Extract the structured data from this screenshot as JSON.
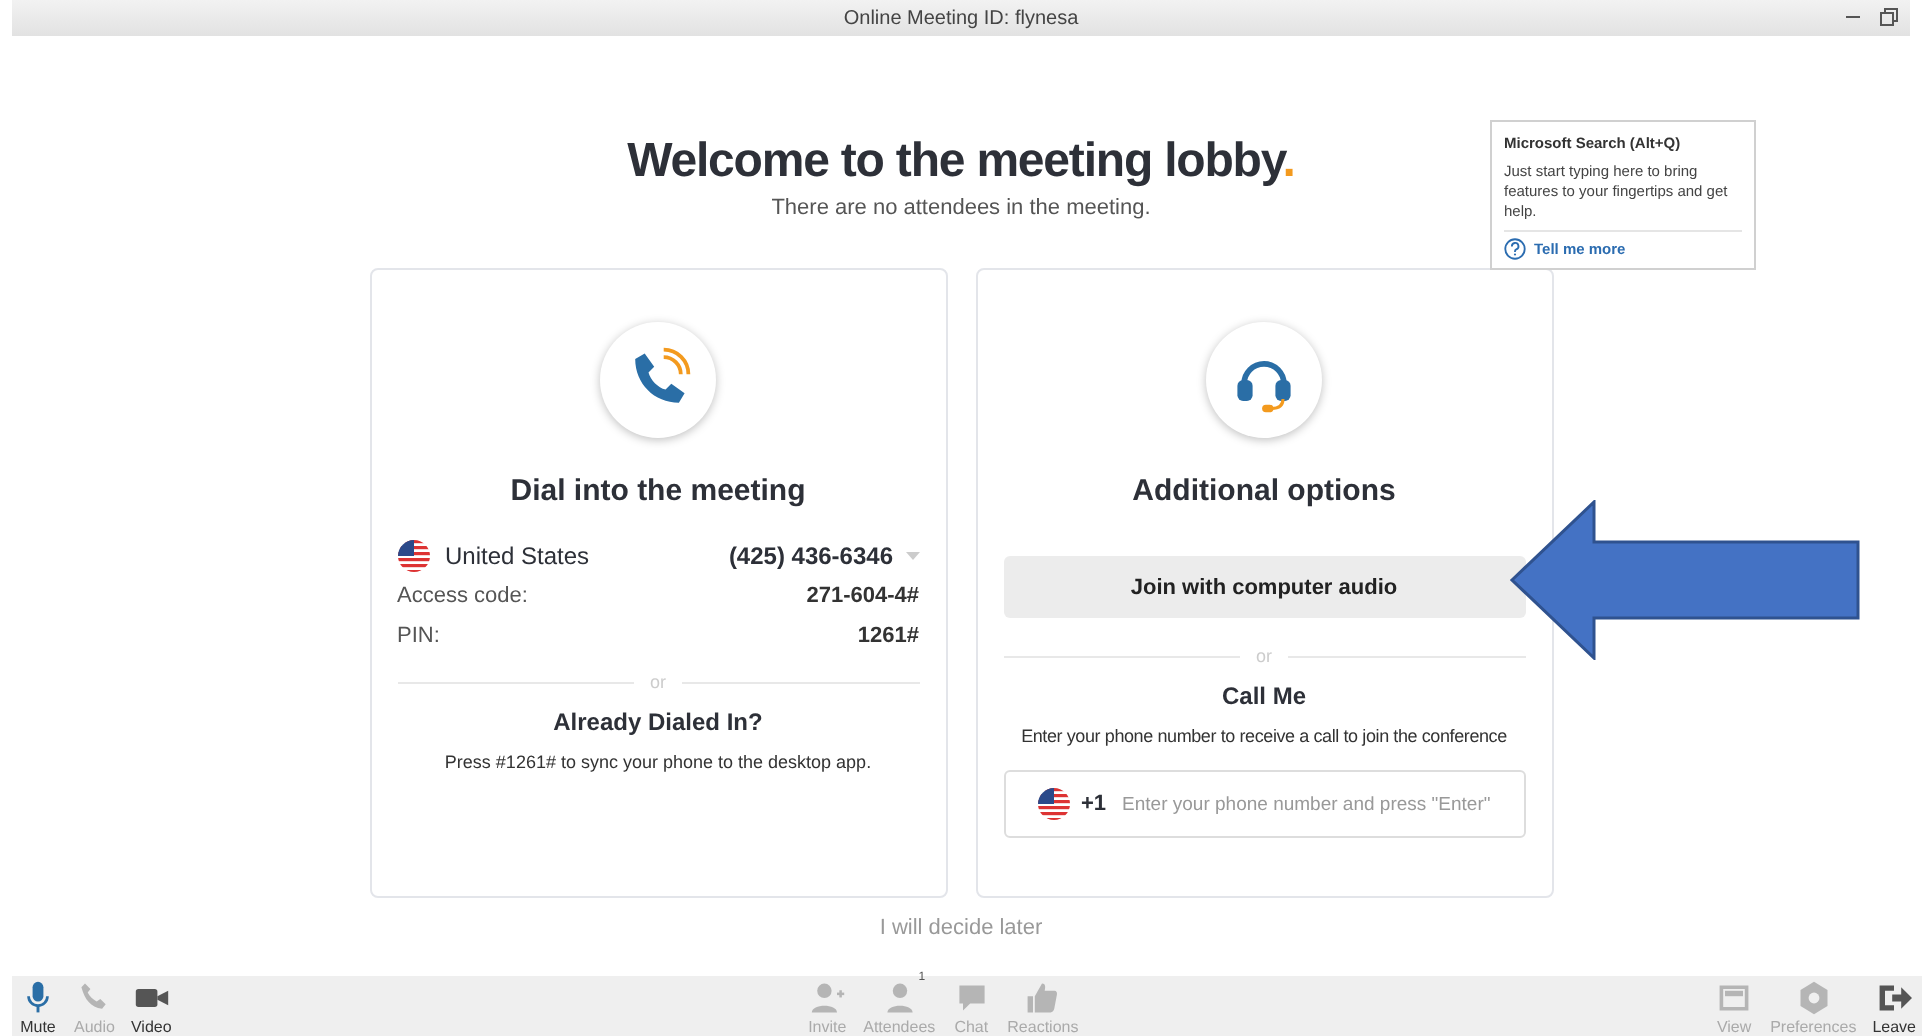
{
  "window": {
    "title": "Online Meeting ID: flynesa"
  },
  "lobby": {
    "heading": "Welcome to the meeting lobby",
    "heading_mark": ".",
    "subtitle": "There are no attendees in the meeting."
  },
  "dial_card": {
    "title": "Dial into the meeting",
    "country": "United States",
    "phone": "(425) 436-6346",
    "rows": [
      {
        "label": "Access code:",
        "value": "271-604-4#"
      },
      {
        "label": "PIN:",
        "value": "1261#"
      }
    ],
    "separator": "or",
    "subtitle": "Already Dialed In?",
    "hint": "Press #1261# to sync your phone to the desktop app."
  },
  "options_card": {
    "title": "Additional options",
    "join_button": "Join with computer audio",
    "separator": "or",
    "call_me": "Call Me",
    "call_me_hint": "Enter your phone number to receive a call to join the conference",
    "country_code": "+1",
    "phone_placeholder": "Enter your phone number and press \"Enter\""
  },
  "decide_later": "I will decide later",
  "tooltip": {
    "title": "Microsoft Search (Alt+Q)",
    "body": "Just start typing here to bring features to your fingertips and get help.",
    "link": "Tell me more"
  },
  "toolbar": {
    "left": [
      {
        "kind": "mic",
        "label": "Mute",
        "active": true,
        "disabled": false
      },
      {
        "kind": "phone",
        "label": "Audio",
        "active": false,
        "disabled": true
      },
      {
        "kind": "camera",
        "label": "Video",
        "active": false,
        "disabled": false
      }
    ],
    "center": [
      {
        "kind": "invite",
        "label": "Invite",
        "active": false,
        "disabled": true
      },
      {
        "kind": "attendees",
        "label": "Attendees",
        "active": false,
        "disabled": true,
        "badge": "1"
      },
      {
        "kind": "chat",
        "label": "Chat",
        "active": false,
        "disabled": true
      },
      {
        "kind": "thumb",
        "label": "Reactions",
        "active": false,
        "disabled": true
      }
    ],
    "right": [
      {
        "kind": "view",
        "label": "View",
        "active": false,
        "disabled": true
      },
      {
        "kind": "gear",
        "label": "Preferences",
        "active": false,
        "disabled": true
      },
      {
        "kind": "leave",
        "label": "Leave",
        "active": false,
        "disabled": false
      }
    ]
  }
}
